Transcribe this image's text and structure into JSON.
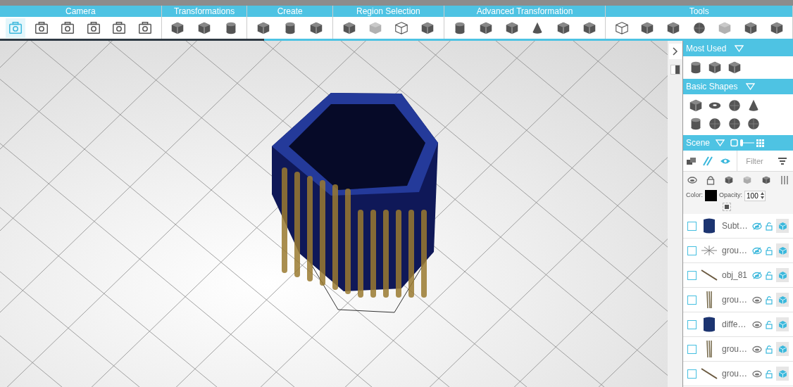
{
  "toolbar": {
    "groups": [
      {
        "label": "Camera",
        "tools": [
          {
            "kind": "camera",
            "selected": true
          },
          {
            "kind": "camera",
            "selected": false
          },
          {
            "kind": "camera",
            "selected": false
          },
          {
            "kind": "camera",
            "selected": false
          },
          {
            "kind": "camera",
            "selected": false
          },
          {
            "kind": "camera",
            "selected": false
          }
        ]
      },
      {
        "label": "Transformations",
        "tools": [
          {
            "kind": "cube",
            "selected": false
          },
          {
            "kind": "cube",
            "selected": false
          },
          {
            "kind": "cylinder",
            "selected": false
          }
        ]
      },
      {
        "label": "Create",
        "tools": [
          {
            "kind": "cube",
            "selected": false
          },
          {
            "kind": "cylinder",
            "selected": false
          },
          {
            "kind": "cube",
            "selected": false
          }
        ]
      },
      {
        "label": "Region Selection",
        "tools": [
          {
            "kind": "cube",
            "selected": false
          },
          {
            "kind": "faded",
            "selected": false
          },
          {
            "kind": "wire",
            "selected": false
          },
          {
            "kind": "cube",
            "selected": false
          }
        ]
      },
      {
        "label": "Advanced Transformation",
        "tools": [
          {
            "kind": "cylinder",
            "selected": false
          },
          {
            "kind": "cube",
            "selected": false
          },
          {
            "kind": "cube",
            "selected": false
          },
          {
            "kind": "cone",
            "selected": false
          },
          {
            "kind": "cube",
            "selected": false
          },
          {
            "kind": "cube",
            "selected": false
          }
        ]
      },
      {
        "label": "Tools",
        "tools": [
          {
            "kind": "wire",
            "selected": false
          },
          {
            "kind": "cube",
            "selected": false
          },
          {
            "kind": "cube",
            "selected": false
          },
          {
            "kind": "sphere",
            "selected": false
          },
          {
            "kind": "faded",
            "selected": false
          },
          {
            "kind": "cube",
            "selected": false
          },
          {
            "kind": "cube",
            "selected": false
          }
        ]
      }
    ]
  },
  "most_used": {
    "title": "Most Used",
    "items": [
      {
        "kind": "cylinder"
      },
      {
        "kind": "cube"
      },
      {
        "kind": "cube"
      }
    ]
  },
  "basic_shapes": {
    "title": "Basic Shapes",
    "items": [
      {
        "kind": "cube"
      },
      {
        "kind": "torus"
      },
      {
        "kind": "sphere"
      },
      {
        "kind": "cone"
      },
      {
        "kind": "cylinder"
      },
      {
        "kind": "sphere"
      },
      {
        "kind": "sphere"
      },
      {
        "kind": "sphere"
      }
    ]
  },
  "scene": {
    "title": "Scene",
    "filter": {
      "placeholder": "Filter"
    },
    "color_label": "Color:",
    "opacity_label": "Opacity:",
    "opacity": "100",
    "objects": [
      {
        "name": "Subt…",
        "kind": "solid",
        "hidden": true,
        "checked": false
      },
      {
        "name": "grou…",
        "kind": "star",
        "hidden": true,
        "checked": false
      },
      {
        "name": "obj_81",
        "kind": "rod",
        "hidden": true,
        "checked": false
      },
      {
        "name": "grou…",
        "kind": "rods",
        "hidden": false,
        "checked": false
      },
      {
        "name": "diffe…",
        "kind": "solid",
        "hidden": false,
        "checked": false
      },
      {
        "name": "grou…",
        "kind": "rods",
        "hidden": false,
        "checked": false
      },
      {
        "name": "grou…",
        "kind": "rod",
        "hidden": false,
        "checked": false
      }
    ]
  }
}
